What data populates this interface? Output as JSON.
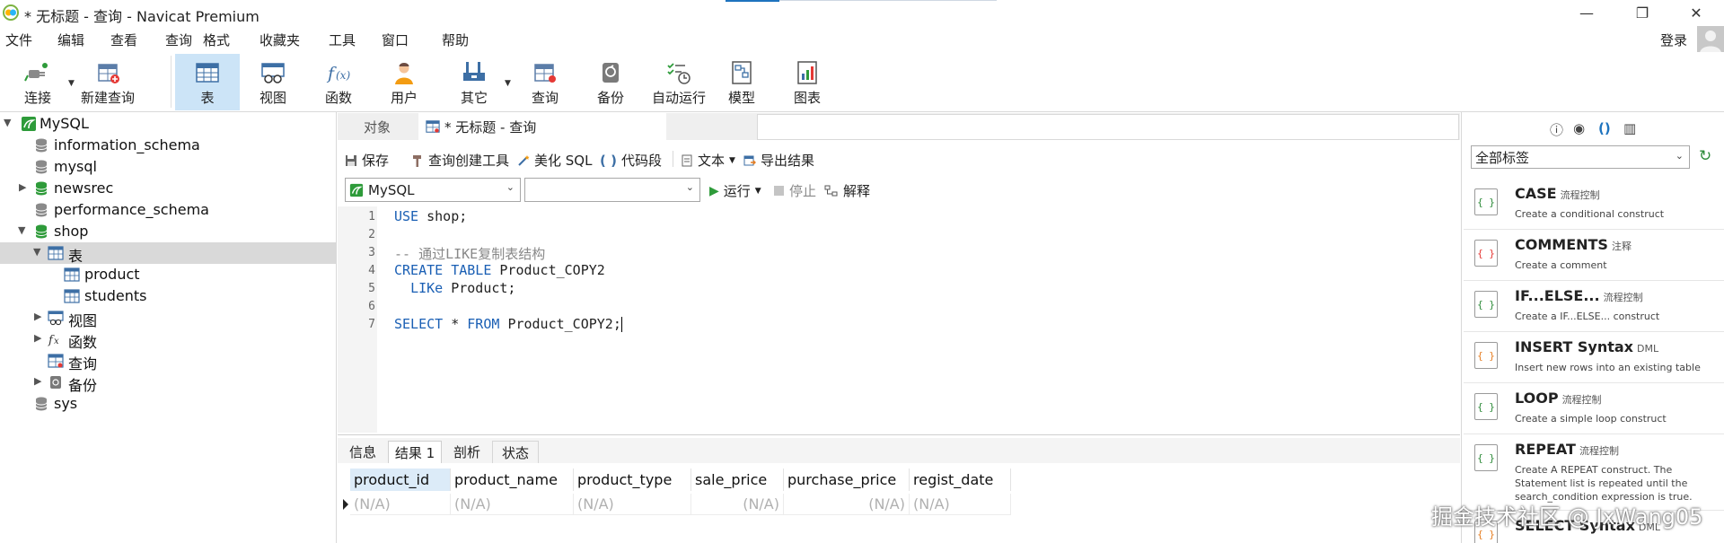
{
  "window": {
    "title": "* 无标题 - 查询 - Navicat Premium",
    "controls": {
      "minimize": "—",
      "maximize": "❐",
      "close": "✕"
    }
  },
  "menu": [
    "文件",
    "编辑",
    "查看",
    "查询",
    "格式",
    "收藏夹",
    "工具",
    "窗口",
    "帮助"
  ],
  "account": {
    "login_label": "登录"
  },
  "toolbar": {
    "items": [
      {
        "label": "连接",
        "icon": "plug-icon"
      },
      {
        "label": "新建查询",
        "icon": "new-query-icon"
      },
      {
        "label": "表",
        "icon": "table-icon",
        "active": true
      },
      {
        "label": "视图",
        "icon": "view-icon"
      },
      {
        "label": "函数",
        "icon": "function-icon"
      },
      {
        "label": "用户",
        "icon": "user-icon"
      },
      {
        "label": "其它",
        "icon": "tools-icon"
      },
      {
        "label": "查询",
        "icon": "query-icon"
      },
      {
        "label": "备份",
        "icon": "backup-icon"
      },
      {
        "label": "自动运行",
        "icon": "automation-icon"
      },
      {
        "label": "模型",
        "icon": "model-icon"
      },
      {
        "label": "图表",
        "icon": "chart-icon"
      }
    ]
  },
  "tree": {
    "connection": "MySQL",
    "databases": [
      "information_schema",
      "mysql",
      "newsrec",
      "performance_schema",
      "shop",
      "sys"
    ],
    "shop_children": {
      "tables_label": "表",
      "tables": [
        "product",
        "students"
      ],
      "views_label": "视图",
      "functions_label": "函数",
      "queries_label": "查询",
      "backups_label": "备份"
    }
  },
  "tabs": {
    "objects": "对象",
    "query": "* 无标题 - 查询"
  },
  "query_toolbar": {
    "save": "保存",
    "builder": "查询创建工具",
    "beautify": "美化 SQL",
    "snippet": "代码段",
    "text": "文本",
    "export": "导出结果",
    "run": "运行",
    "stop": "停止",
    "explain": "解释"
  },
  "connection_select": {
    "value": "MySQL"
  },
  "database_select": {
    "value": ""
  },
  "editor": {
    "lines": [
      {
        "n": "1",
        "text": "USE shop;"
      },
      {
        "n": "2",
        "text": ""
      },
      {
        "n": "3",
        "text": "-- 通过LIKE复制表结构"
      },
      {
        "n": "4",
        "text": "CREATE TABLE Product_COPY2"
      },
      {
        "n": "5",
        "text": "  LIKe Product;"
      },
      {
        "n": "6",
        "text": ""
      },
      {
        "n": "7",
        "text": "SELECT * FROM Product_COPY2;"
      }
    ]
  },
  "result_tabs": [
    "信息",
    "结果 1",
    "剖析",
    "状态"
  ],
  "result_grid": {
    "columns": [
      "product_id",
      "product_name",
      "product_type",
      "sale_price",
      "purchase_price",
      "regist_date"
    ],
    "row": [
      "(N/A)",
      "(N/A)",
      "(N/A)",
      "(N/A)",
      "(N/A)",
      "(N/A)"
    ]
  },
  "snippet_panel": {
    "filter": "全部标签",
    "items": [
      {
        "title": "CASE",
        "tag": "流程控制",
        "desc": "Create a conditional construct"
      },
      {
        "title": "COMMENTS",
        "tag": "注释",
        "desc": "Create a comment"
      },
      {
        "title": "IF...ELSE...",
        "tag": "流程控制",
        "desc": "Create a IF...ELSE... construct"
      },
      {
        "title": "INSERT Syntax",
        "tag": "DML",
        "desc": "Insert new rows into an existing table"
      },
      {
        "title": "LOOP",
        "tag": "流程控制",
        "desc": "Create a simple loop construct"
      },
      {
        "title": "REPEAT",
        "tag": "流程控制",
        "desc": "Create A REPEAT construct. The Statement list is repeated until the search_condition expression is true."
      },
      {
        "title": "SELECT Syntax",
        "tag": "DML",
        "desc": ""
      }
    ]
  },
  "watermark": "掘金技术社区 @ JxWang05",
  "colors": {
    "accent": "#1e73be",
    "selection": "#cce4f7",
    "keyword": "#1a5fb4",
    "run_green": "#2e9b3a"
  }
}
